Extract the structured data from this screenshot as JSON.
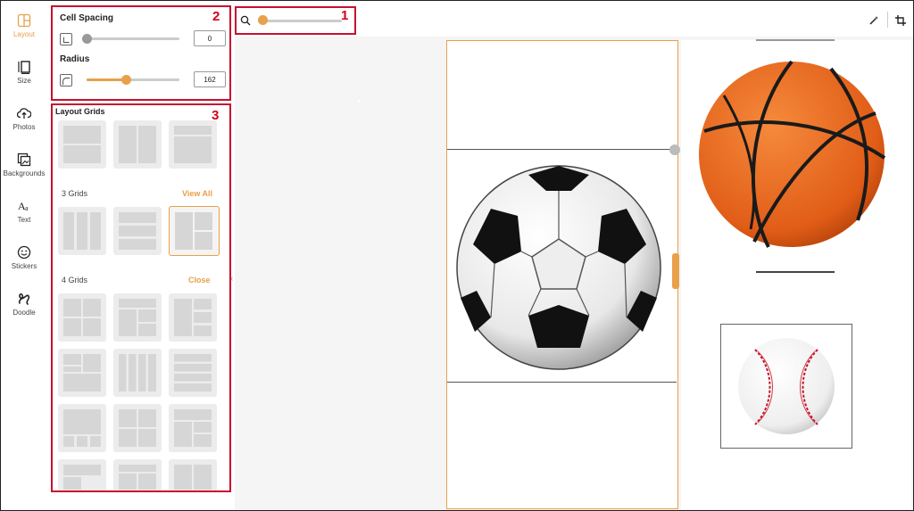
{
  "rail": {
    "items": [
      {
        "label": "Layout",
        "icon": "layout-icon"
      },
      {
        "label": "Size",
        "icon": "size-icon"
      },
      {
        "label": "Photos",
        "icon": "upload-icon"
      },
      {
        "label": "Backgrounds",
        "icon": "backgrounds-icon"
      },
      {
        "label": "Text",
        "icon": "text-icon"
      },
      {
        "label": "Stickers",
        "icon": "smiley-icon"
      },
      {
        "label": "Doodle",
        "icon": "doodle-icon"
      }
    ],
    "active_color": "#e8a04a"
  },
  "panel": {
    "cell_spacing": {
      "title": "Cell Spacing",
      "value": "0",
      "level": 0
    },
    "radius": {
      "title": "Radius",
      "value": "162",
      "level": 0.42
    },
    "layout_grids_title": "Layout Grids",
    "three_grids": {
      "label": "3 Grids",
      "action": "View All"
    },
    "four_grids": {
      "label": "4 Grids",
      "action": "Close"
    }
  },
  "zoom": {
    "level": 0.05
  },
  "annotations": {
    "one": "1",
    "two": "2",
    "three": "3"
  },
  "colors": {
    "accent": "#e8a04a",
    "annotation": "#c8102e"
  }
}
